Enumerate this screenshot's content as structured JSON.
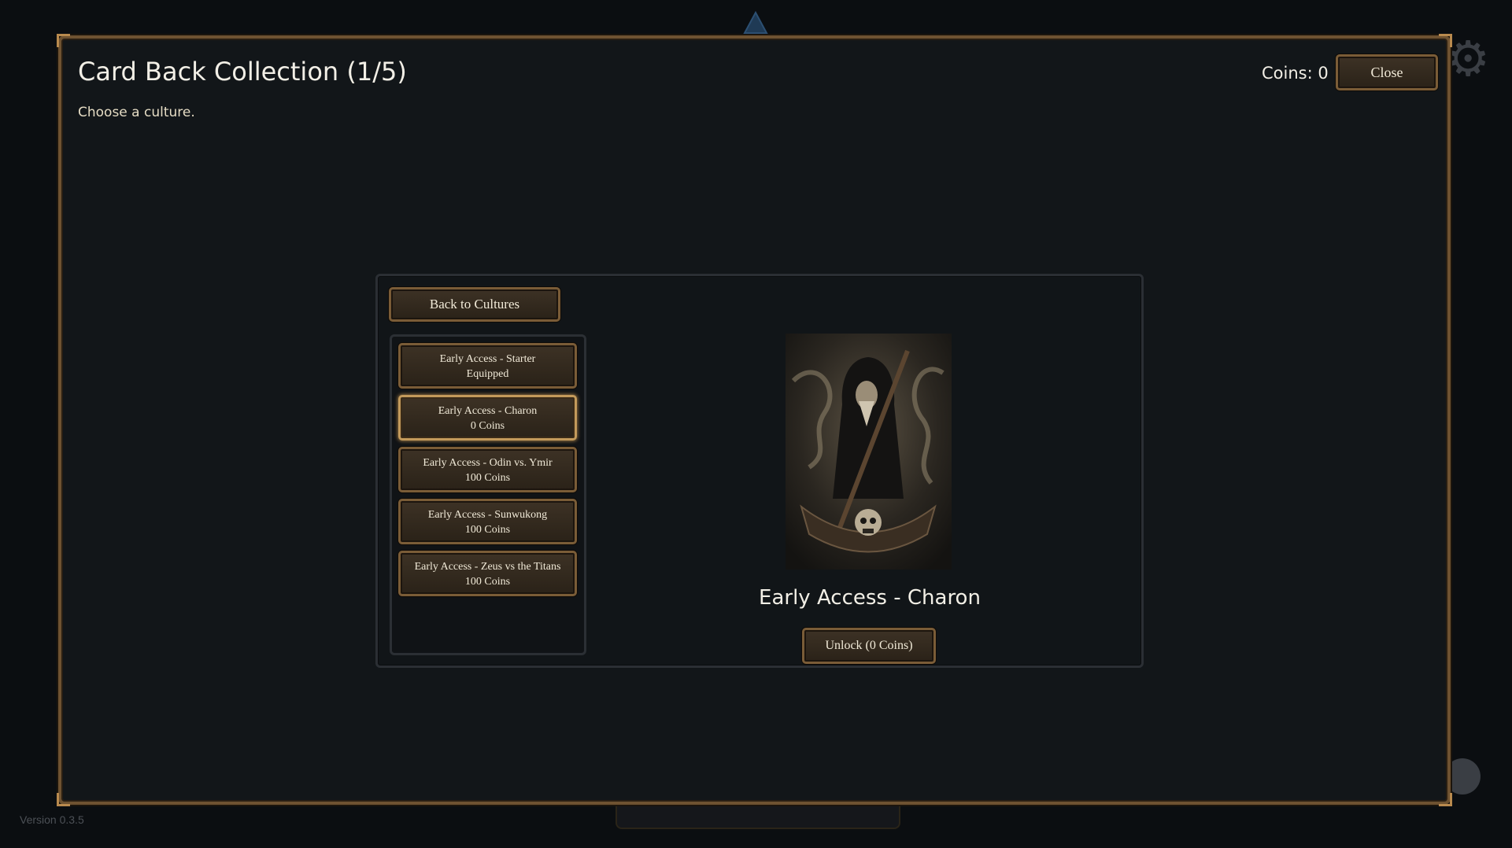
{
  "modal": {
    "title": "Card Back Collection (1/5)",
    "subtitle": "Choose a culture.",
    "coins_label": "Coins: 0",
    "close_label": "Close"
  },
  "panel": {
    "back_label": "Back to Cultures",
    "items": [
      {
        "name": "Early Access - Starter",
        "status": "Equipped",
        "selected": false
      },
      {
        "name": "Early Access - Charon",
        "status": "0 Coins",
        "selected": true
      },
      {
        "name": "Early Access - Odin vs. Ymir",
        "status": "100 Coins",
        "selected": false
      },
      {
        "name": "Early Access - Sunwukong",
        "status": "100 Coins",
        "selected": false
      },
      {
        "name": "Early Access - Zeus vs the Titans",
        "status": "100 Coins",
        "selected": false
      }
    ],
    "preview": {
      "name": "Early Access - Charon",
      "unlock_label": "Unlock (0 Coins)",
      "image_icon": "hooded-ferryman-boat-skull-art"
    }
  },
  "footer": {
    "version": "Version 0.3.5"
  },
  "colors": {
    "frame_gold": "#6e5231",
    "accent_gold": "#c39a5b",
    "background": "#0b0e11",
    "modal_bg": "#121619"
  }
}
